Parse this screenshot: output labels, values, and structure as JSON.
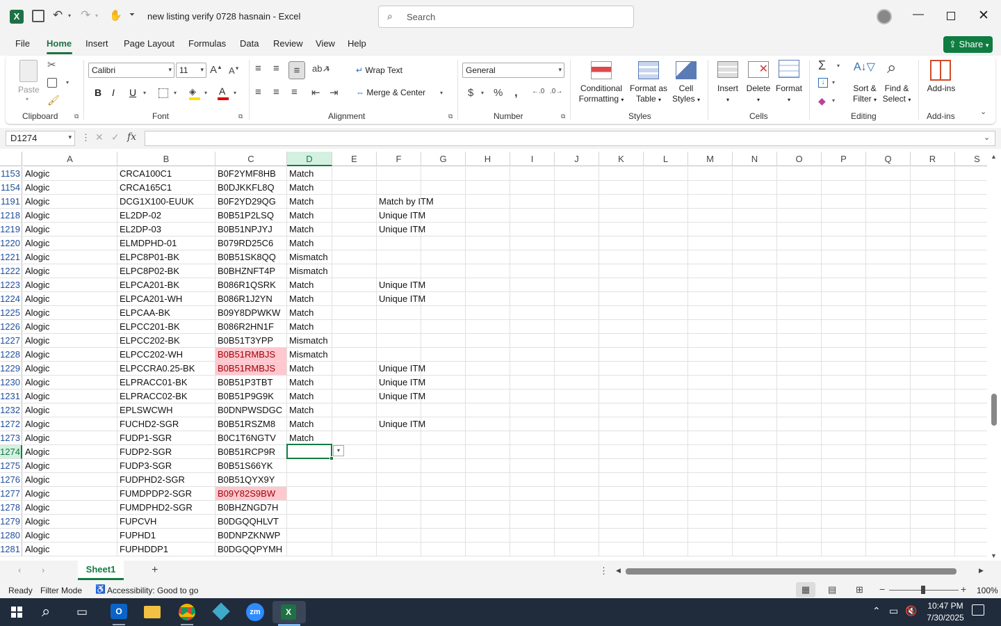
{
  "titlebar": {
    "doc_title": "new listing verify 0728 hasnain  -  Excel",
    "search_placeholder": "Search"
  },
  "tabs": [
    "File",
    "Home",
    "Insert",
    "Page Layout",
    "Formulas",
    "Data",
    "Review",
    "View",
    "Help"
  ],
  "share_label": "Share",
  "ribbon": {
    "clipboard": {
      "paste": "Paste",
      "group": "Clipboard"
    },
    "font": {
      "name": "Calibri",
      "size": "11",
      "group": "Font"
    },
    "alignment": {
      "wrap": "Wrap Text",
      "merge": "Merge & Center",
      "group": "Alignment"
    },
    "number": {
      "format": "General",
      "group": "Number"
    },
    "styles": {
      "cond1": "Conditional",
      "cond2": "Formatting",
      "fmt1": "Format as",
      "fmt2": "Table",
      "cs1": "Cell",
      "cs2": "Styles",
      "group": "Styles"
    },
    "cells": {
      "insert": "Insert",
      "delete": "Delete",
      "format": "Format",
      "group": "Cells"
    },
    "editing": {
      "sort1": "Sort &",
      "sort2": "Filter",
      "find1": "Find &",
      "find2": "Select",
      "group": "Editing"
    },
    "addins": {
      "label": "Add-ins",
      "group": "Add-ins"
    }
  },
  "formula_bar": {
    "name_box": "D1274",
    "fx": "fx",
    "value": ""
  },
  "columns": [
    "A",
    "B",
    "C",
    "D",
    "E",
    "F",
    "G",
    "H",
    "I",
    "J",
    "K",
    "L",
    "M",
    "N",
    "O",
    "P",
    "Q",
    "R",
    "S"
  ],
  "rows": [
    {
      "n": "1153",
      "a": "Alogic",
      "b": "CRCA100C1",
      "c": "B0F2YMF8HB",
      "d": "Match",
      "f": "",
      "pink": false
    },
    {
      "n": "1154",
      "a": "Alogic",
      "b": "CRCA165C1",
      "c": "B0DJKKFL8Q",
      "d": "Match",
      "f": "",
      "pink": false
    },
    {
      "n": "1191",
      "a": "Alogic",
      "b": "DCG1X100-EUUK",
      "c": "B0F2YD29QG",
      "d": "Match",
      "f": "Match by ITM",
      "pink": false
    },
    {
      "n": "1218",
      "a": "Alogic",
      "b": "EL2DP-02",
      "c": "B0B51P2LSQ",
      "d": "Match",
      "f": "Unique ITM",
      "pink": false
    },
    {
      "n": "1219",
      "a": "Alogic",
      "b": "EL2DP-03",
      "c": "B0B51NPJYJ",
      "d": "Match",
      "f": "Unique ITM",
      "pink": false
    },
    {
      "n": "1220",
      "a": "Alogic",
      "b": "ELMDPHD-01",
      "c": "B079RD25C6",
      "d": "Match",
      "f": "",
      "pink": false
    },
    {
      "n": "1221",
      "a": "Alogic",
      "b": "ELPC8P01-BK",
      "c": "B0B51SK8QQ",
      "d": "Mismatch",
      "f": "",
      "pink": false
    },
    {
      "n": "1222",
      "a": "Alogic",
      "b": "ELPC8P02-BK",
      "c": "B0BHZNFT4P",
      "d": "Mismatch",
      "f": "",
      "pink": false
    },
    {
      "n": "1223",
      "a": "Alogic",
      "b": "ELPCA201-BK",
      "c": "B086R1QSRK",
      "d": "Match",
      "f": "Unique ITM",
      "pink": false
    },
    {
      "n": "1224",
      "a": "Alogic",
      "b": "ELPCA201-WH",
      "c": "B086R1J2YN",
      "d": "Match",
      "f": "Unique ITM",
      "pink": false
    },
    {
      "n": "1225",
      "a": "Alogic",
      "b": "ELPCAA-BK",
      "c": "B09Y8DPWKW",
      "d": "Match",
      "f": "",
      "pink": false
    },
    {
      "n": "1226",
      "a": "Alogic",
      "b": "ELPCC201-BK",
      "c": "B086R2HN1F",
      "d": "Match",
      "f": "",
      "pink": false
    },
    {
      "n": "1227",
      "a": "Alogic",
      "b": "ELPCC202-BK",
      "c": "B0B51T3YPP",
      "d": "Mismatch",
      "f": "",
      "pink": false
    },
    {
      "n": "1228",
      "a": "Alogic",
      "b": "ELPCC202-WH",
      "c": "B0B51RMBJS",
      "d": "Mismatch",
      "f": "",
      "pink": true
    },
    {
      "n": "1229",
      "a": "Alogic",
      "b": "ELPCCRA0.25-BK",
      "c": "B0B51RMBJS",
      "d": "Match",
      "f": "Unique ITM",
      "pink": true
    },
    {
      "n": "1230",
      "a": "Alogic",
      "b": "ELPRACC01-BK",
      "c": "B0B51P3TBT",
      "d": "Match",
      "f": "Unique ITM",
      "pink": false
    },
    {
      "n": "1231",
      "a": "Alogic",
      "b": "ELPRACC02-BK",
      "c": "B0B51P9G9K",
      "d": "Match",
      "f": "Unique ITM",
      "pink": false
    },
    {
      "n": "1232",
      "a": "Alogic",
      "b": "EPLSWCWH",
      "c": "B0DNPWSDGC",
      "d": "Match",
      "f": "",
      "pink": false
    },
    {
      "n": "1272",
      "a": "Alogic",
      "b": "FUCHD2-SGR",
      "c": "B0B51RSZM8",
      "d": "Match",
      "f": "Unique ITM",
      "pink": false
    },
    {
      "n": "1273",
      "a": "Alogic",
      "b": "FUDP1-SGR",
      "c": "B0C1T6NGTV",
      "d": "Match",
      "f": "",
      "pink": false
    },
    {
      "n": "1274",
      "a": "Alogic",
      "b": "FUDP2-SGR",
      "c": "B0B51RCP9R",
      "d": "",
      "f": "",
      "pink": false
    },
    {
      "n": "1275",
      "a": "Alogic",
      "b": "FUDP3-SGR",
      "c": "B0B51S66YK",
      "d": "",
      "f": "",
      "pink": false
    },
    {
      "n": "1276",
      "a": "Alogic",
      "b": "FUDPHD2-SGR",
      "c": "B0B51QYX9Y",
      "d": "",
      "f": "",
      "pink": false
    },
    {
      "n": "1277",
      "a": "Alogic",
      "b": "FUMDPDP2-SGR",
      "c": "B09Y82S9BW",
      "d": "",
      "f": "",
      "pink": true
    },
    {
      "n": "1278",
      "a": "Alogic",
      "b": "FUMDPHD2-SGR",
      "c": "B0BHZNGD7H",
      "d": "",
      "f": "",
      "pink": false
    },
    {
      "n": "1279",
      "a": "Alogic",
      "b": "FUPCVH",
      "c": "B0DGQQHLVT",
      "d": "",
      "f": "",
      "pink": false
    },
    {
      "n": "1280",
      "a": "Alogic",
      "b": "FUPHD1",
      "c": "B0DNPZKNWP",
      "d": "",
      "f": "",
      "pink": false
    },
    {
      "n": "1281",
      "a": "Alogic",
      "b": "FUPHDDP1",
      "c": "B0DGQQPYMH",
      "d": "",
      "f": "",
      "pink": false
    }
  ],
  "sheet_tab": "Sheet1",
  "status": {
    "ready": "Ready",
    "filter": "Filter Mode",
    "access": "Accessibility: Good to go",
    "zoom": "100%"
  },
  "clock": {
    "time": "10:47 PM",
    "date": "7/30/2025"
  },
  "colors": {
    "excel_green": "#1e7145",
    "share_green": "#107c41",
    "pink_fill": "#ffc7ce",
    "pink_text": "#9c0006",
    "taskbar": "#202b3c"
  }
}
